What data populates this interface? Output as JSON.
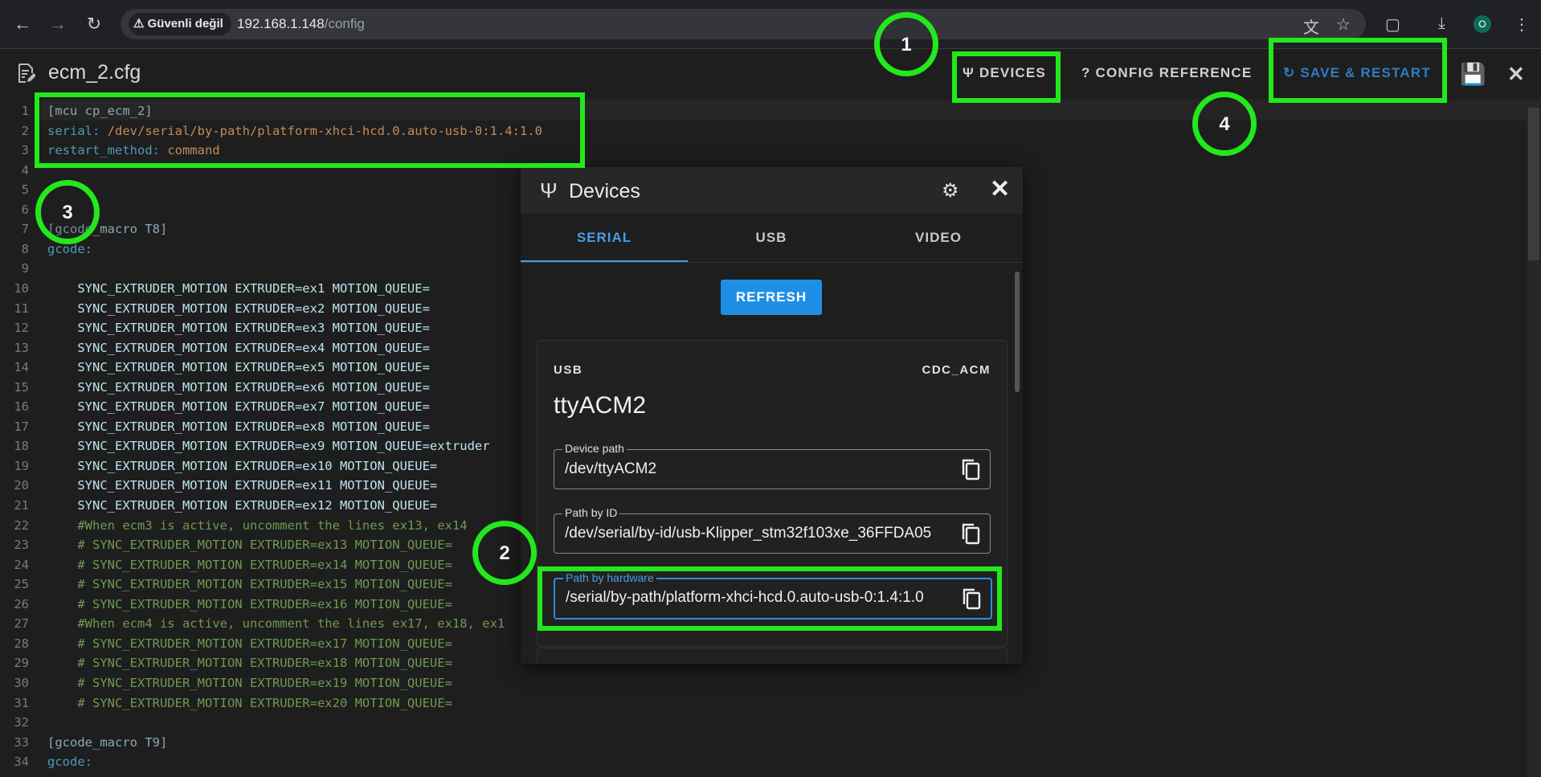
{
  "browser": {
    "security_label": "Güvenli değil",
    "url_host": "192.168.1.148",
    "url_path": "/config",
    "profile_initial": "O"
  },
  "header": {
    "filename": "ecm_2.cfg",
    "devices_label": "DEVICES",
    "config_reference_label": "CONFIG REFERENCE",
    "save_restart_label": "SAVE & RESTART"
  },
  "editor": {
    "lines": [
      {
        "n": "1",
        "parts": [
          {
            "t": "[mcu cp_ecm_2]",
            "c": "c-sec"
          }
        ]
      },
      {
        "n": "2",
        "parts": [
          {
            "t": "serial: ",
            "c": "c-key"
          },
          {
            "t": "/dev/serial/by-path/platform-xhci-hcd.0.auto-usb-0:1.4:1.0",
            "c": "c-val"
          }
        ]
      },
      {
        "n": "3",
        "parts": [
          {
            "t": "restart_method: ",
            "c": "c-key"
          },
          {
            "t": "command",
            "c": "c-val"
          }
        ]
      },
      {
        "n": "4",
        "parts": []
      },
      {
        "n": "5",
        "parts": []
      },
      {
        "n": "6",
        "parts": []
      },
      {
        "n": "7",
        "parts": [
          {
            "t": "[gcode_macro T8]",
            "c": "c-sec"
          }
        ]
      },
      {
        "n": "8",
        "parts": [
          {
            "t": "gcode:",
            "c": "c-key"
          }
        ]
      },
      {
        "n": "9",
        "parts": []
      },
      {
        "n": "10",
        "parts": [
          {
            "t": "    SYNC_EXTRUDER_MOTION EXTRUDER=ex1 MOTION_QUEUE=",
            "c": "c-cmd"
          }
        ]
      },
      {
        "n": "11",
        "parts": [
          {
            "t": "    SYNC_EXTRUDER_MOTION EXTRUDER=ex2 MOTION_QUEUE=",
            "c": "c-cmd"
          }
        ]
      },
      {
        "n": "12",
        "parts": [
          {
            "t": "    SYNC_EXTRUDER_MOTION EXTRUDER=ex3 MOTION_QUEUE=",
            "c": "c-cmd"
          }
        ]
      },
      {
        "n": "13",
        "parts": [
          {
            "t": "    SYNC_EXTRUDER_MOTION EXTRUDER=ex4 MOTION_QUEUE=",
            "c": "c-cmd"
          }
        ]
      },
      {
        "n": "14",
        "parts": [
          {
            "t": "    SYNC_EXTRUDER_MOTION EXTRUDER=ex5 MOTION_QUEUE=",
            "c": "c-cmd"
          }
        ]
      },
      {
        "n": "15",
        "parts": [
          {
            "t": "    SYNC_EXTRUDER_MOTION EXTRUDER=ex6 MOTION_QUEUE=",
            "c": "c-cmd"
          }
        ]
      },
      {
        "n": "16",
        "parts": [
          {
            "t": "    SYNC_EXTRUDER_MOTION EXTRUDER=ex7 MOTION_QUEUE=",
            "c": "c-cmd"
          }
        ]
      },
      {
        "n": "17",
        "parts": [
          {
            "t": "    SYNC_EXTRUDER_MOTION EXTRUDER=ex8 MOTION_QUEUE=",
            "c": "c-cmd"
          }
        ]
      },
      {
        "n": "18",
        "parts": [
          {
            "t": "    SYNC_EXTRUDER_MOTION EXTRUDER=ex9 MOTION_QUEUE=extruder",
            "c": "c-cmd"
          }
        ]
      },
      {
        "n": "19",
        "parts": [
          {
            "t": "    SYNC_EXTRUDER_MOTION EXTRUDER=ex10 MOTION_QUEUE=",
            "c": "c-cmd"
          }
        ]
      },
      {
        "n": "20",
        "parts": [
          {
            "t": "    SYNC_EXTRUDER_MOTION EXTRUDER=ex11 MOTION_QUEUE=",
            "c": "c-cmd"
          }
        ]
      },
      {
        "n": "21",
        "parts": [
          {
            "t": "    SYNC_EXTRUDER_MOTION EXTRUDER=ex12 MOTION_QUEUE=",
            "c": "c-cmd"
          }
        ]
      },
      {
        "n": "22",
        "parts": [
          {
            "t": "    #When ecm3 is active, uncomment the lines ex13, ex14",
            "c": "c-com"
          }
        ]
      },
      {
        "n": "23",
        "parts": [
          {
            "t": "    # SYNC_EXTRUDER_MOTION EXTRUDER=ex13 MOTION_QUEUE=",
            "c": "c-com"
          }
        ]
      },
      {
        "n": "24",
        "parts": [
          {
            "t": "    # SYNC_EXTRUDER_MOTION EXTRUDER=ex14 MOTION_QUEUE=",
            "c": "c-com"
          }
        ]
      },
      {
        "n": "25",
        "parts": [
          {
            "t": "    # SYNC_EXTRUDER_MOTION EXTRUDER=ex15 MOTION_QUEUE=",
            "c": "c-com"
          }
        ]
      },
      {
        "n": "26",
        "parts": [
          {
            "t": "    # SYNC_EXTRUDER_MOTION EXTRUDER=ex16 MOTION_QUEUE=",
            "c": "c-com"
          }
        ]
      },
      {
        "n": "27",
        "parts": [
          {
            "t": "    #When ecm4 is active, uncomment the lines ex17, ex18, ex1",
            "c": "c-com"
          }
        ]
      },
      {
        "n": "28",
        "parts": [
          {
            "t": "    # SYNC_EXTRUDER_MOTION EXTRUDER=ex17 MOTION_QUEUE=",
            "c": "c-com"
          }
        ]
      },
      {
        "n": "29",
        "parts": [
          {
            "t": "    # SYNC_EXTRUDER_MOTION EXTRUDER=ex18 MOTION_QUEUE=",
            "c": "c-com"
          }
        ]
      },
      {
        "n": "30",
        "parts": [
          {
            "t": "    # SYNC_EXTRUDER_MOTION EXTRUDER=ex19 MOTION_QUEUE=",
            "c": "c-com"
          }
        ]
      },
      {
        "n": "31",
        "parts": [
          {
            "t": "    # SYNC_EXTRUDER_MOTION EXTRUDER=ex20 MOTION_QUEUE=",
            "c": "c-com"
          }
        ]
      },
      {
        "n": "32",
        "parts": []
      },
      {
        "n": "33",
        "parts": [
          {
            "t": "[gcode_macro T9]",
            "c": "c-sec"
          }
        ]
      },
      {
        "n": "34",
        "parts": [
          {
            "t": "gcode:",
            "c": "c-key"
          }
        ]
      }
    ]
  },
  "dialog": {
    "title": "Devices",
    "tabs": [
      "SERIAL",
      "USB",
      "VIDEO"
    ],
    "active_tab": "SERIAL",
    "refresh_label": "REFRESH",
    "device": {
      "type": "USB",
      "driver": "CDC_ACM",
      "name": "ttyACM2",
      "device_path_label": "Device path",
      "device_path": "/dev/ttyACM2",
      "path_by_id_label": "Path by ID",
      "path_by_id": "/dev/serial/by-id/usb-Klipper_stm32f103xe_36FFDA05",
      "path_by_hardware_label": "Path by hardware",
      "path_by_hardware": "/serial/by-path/platform-xhci-hcd.0.auto-usb-0:1.4:1.0"
    }
  },
  "annotations": {
    "step_1": "1",
    "step_2": "2",
    "step_3": "3",
    "step_4": "4",
    "color": "#22e81c"
  }
}
